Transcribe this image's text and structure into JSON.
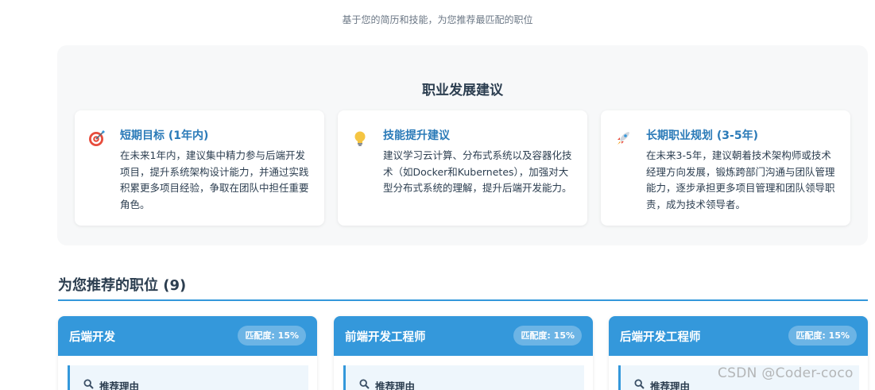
{
  "subtitle": "基于您的简历和技能，为您推荐最匹配的职位",
  "career_advice": {
    "title": "职业发展建议",
    "cards": [
      {
        "icon": "target-icon",
        "heading": "短期目标 (1年内)",
        "text": "在未来1年内，建议集中精力参与后端开发项目，提升系统架构设计能力，并通过实践积累更多项目经验，争取在团队中担任重要角色。"
      },
      {
        "icon": "lightbulb-icon",
        "heading": "技能提升建议",
        "text": "建议学习云计算、分布式系统以及容器化技术（如Docker和Kubernetes），加强对大型分布式系统的理解，提升后端开发能力。"
      },
      {
        "icon": "rocket-icon",
        "heading": "长期职业规划 (3-5年)",
        "text": "在未来3-5年，建议朝着技术架构师或技术经理方向发展，锻炼跨部门沟通与团队管理能力，逐步承担更多项目管理和团队领导职责，成为技术领导者。"
      }
    ]
  },
  "recommended": {
    "title": "为您推荐的职位 (9)",
    "jobs": [
      {
        "title": "后端开发",
        "match": "匹配度: 15%",
        "reason_label": "推荐理由"
      },
      {
        "title": "前端开发工程师",
        "match": "匹配度: 15%",
        "reason_label": "推荐理由"
      },
      {
        "title": "后端开发工程师",
        "match": "匹配度: 15%",
        "reason_label": "推荐理由"
      }
    ]
  },
  "watermark": "CSDN @Coder-coco",
  "colors": {
    "accent": "#3498db",
    "heading_blue": "#2a7ab8",
    "text": "#2c3e50",
    "panel_bg": "#f7f8f9"
  }
}
